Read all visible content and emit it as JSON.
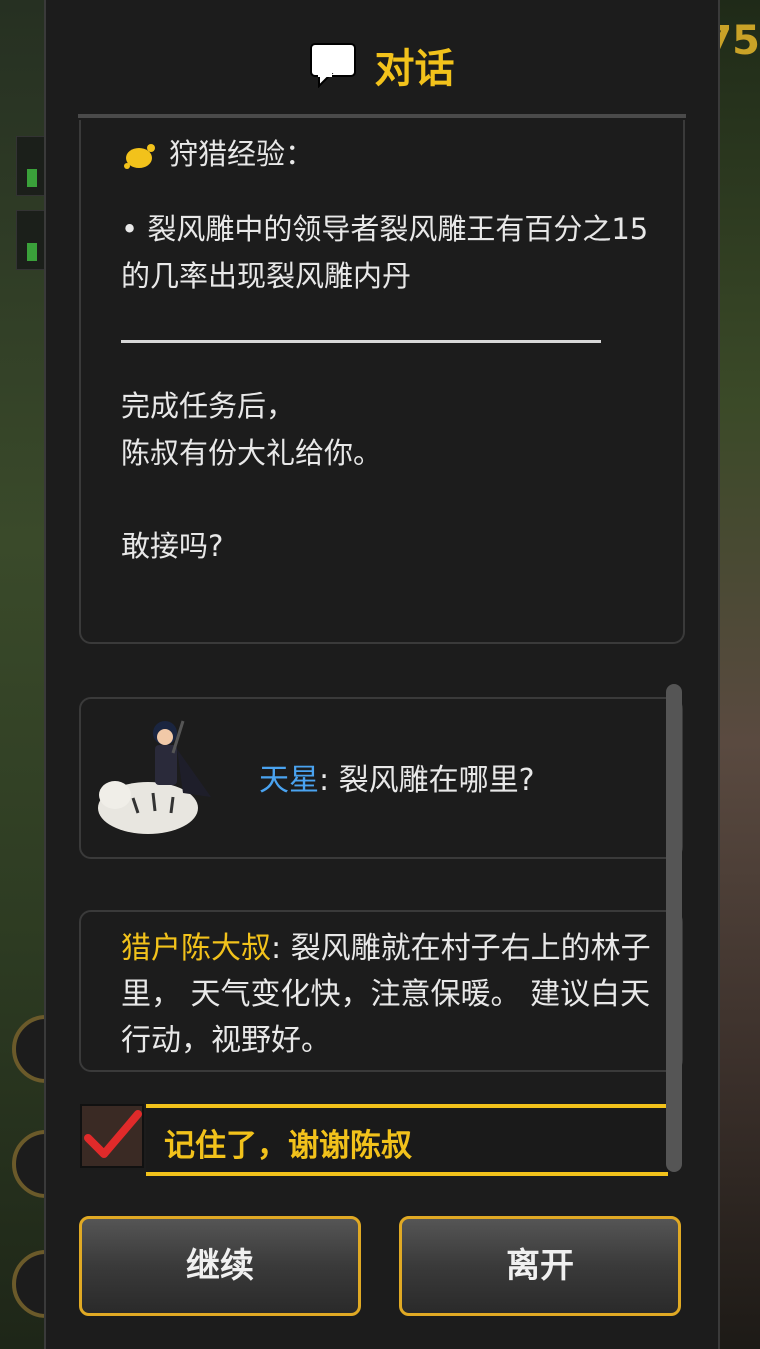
{
  "background": {
    "top_right_number": "75"
  },
  "dialog": {
    "title": "对话",
    "title_icon": "chat-bubble-icon",
    "quest": {
      "header": "狩猎经验：",
      "header_icon": "paw-icon",
      "bullet": "• 裂风雕中的领导者裂风雕王有百分之15的几率出现裂风雕内丹",
      "line1": "完成任务后，",
      "line2": "陈叔有份大礼给你。",
      "line3": "敢接吗?"
    },
    "player": {
      "name": "天星",
      "message": ": 裂风雕在哪里?"
    },
    "npc": {
      "name": "猎户陈大叔",
      "message": ": 裂风雕就在村子右上的林子里， 天气变化快，注意保暖。 建议白天行动，视野好。"
    },
    "choice": {
      "label": "记住了，谢谢陈叔",
      "checked": true
    },
    "buttons": {
      "continue": "继续",
      "leave": "离开"
    }
  },
  "colors": {
    "accent": "#f2c21b",
    "player_name": "#4aa3f0",
    "border_gold": "#e0a924"
  }
}
